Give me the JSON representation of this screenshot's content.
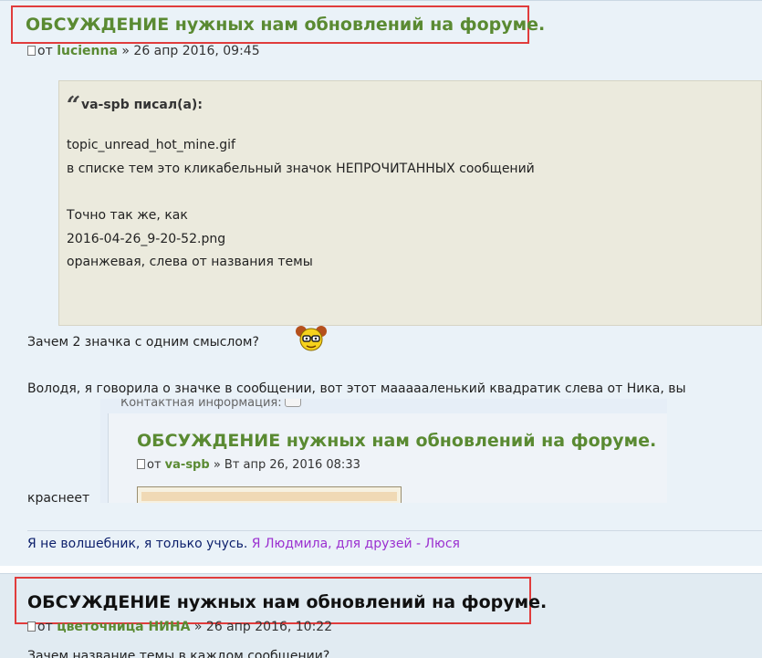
{
  "posts": [
    {
      "title": "ОБСУЖДЕНИЕ нужных нам обновлений на форуме.",
      "meta_prefix": "от",
      "author": "lucienna",
      "date": "» 26 апр 2016, 09:45",
      "quote": {
        "header": "va-spb писал(а):",
        "lines": [
          "topic_unread_hot_mine.gif",
          "в списке тем это кликабельный значок НЕПРОЧИТАННЫХ сообщений",
          "",
          "Точно так же, как",
          "2016-04-26_9-20-52.png",
          "оранжевая, слева от названия темы"
        ]
      },
      "body": [
        "Зачем 2 значка с одним смыслом?",
        "Володя, я говорила о значке в сообщении, вот этот маааааленький квадратик слева от Ника, вы",
        "краснеет"
      ],
      "embedded_screenshot": {
        "contact_label": "Контактная информация:",
        "title": "ОБСУЖДЕНИЕ нужных нам обновлений на форуме.",
        "meta_prefix": "от",
        "author": "va-spb",
        "date": "» Вт апр 26, 2016 08:33"
      },
      "signature": {
        "text": "Я не волшебник, я только учусь.",
        "name": "Я Людмила, для друзей - Люся"
      }
    },
    {
      "title": "ОБСУЖДЕНИЕ нужных нам обновлений на форуме.",
      "meta_prefix": "от",
      "author": "цветочница НИНА",
      "date": "» 26 апр 2016, 10:22",
      "body": [
        "Зачем название темы в каждом сообщении?"
      ]
    }
  ],
  "colors": {
    "title_green": "#5a8a32",
    "highlight_border": "#e03c3c",
    "quote_bg": "#ebeadd",
    "signature_blue": "#0c1f6b",
    "signature_purple": "#9b30d0"
  },
  "icons": [
    "post-doc-icon",
    "quote-mark-icon",
    "smiley-nerd-icon",
    "speech-bubble-icon"
  ]
}
